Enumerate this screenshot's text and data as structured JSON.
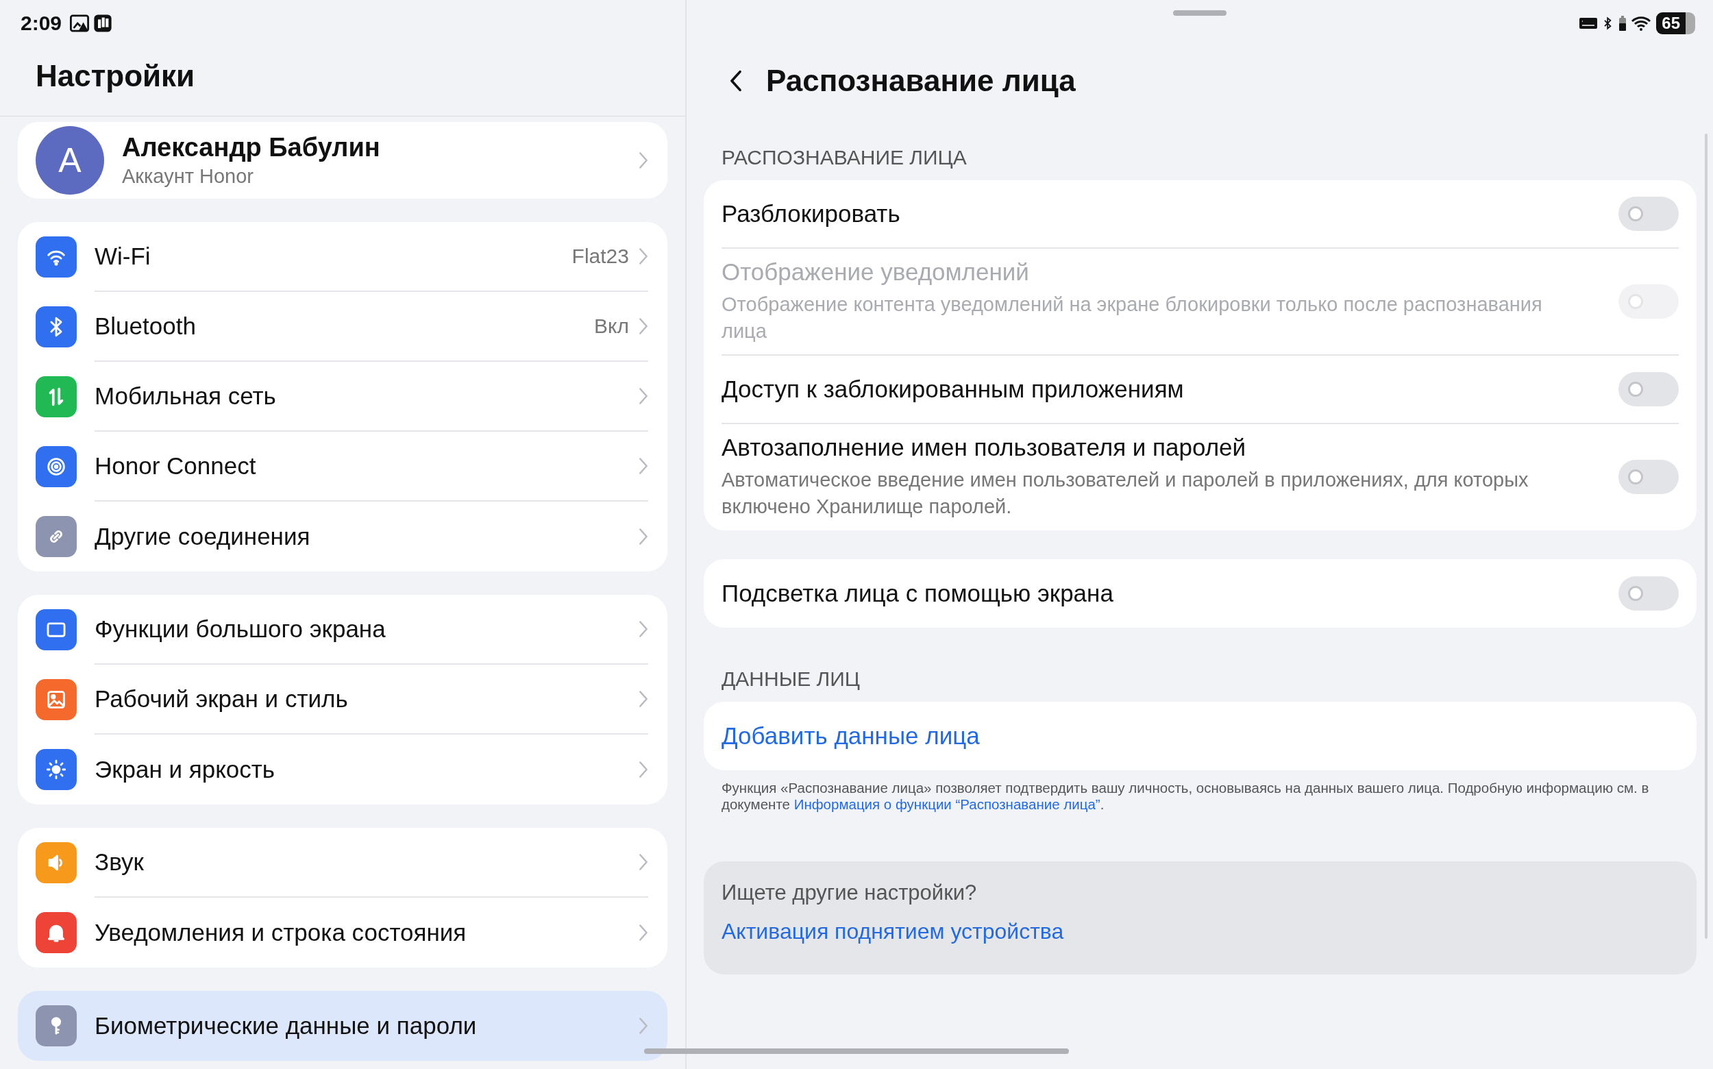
{
  "status_bar": {
    "time": "2:09",
    "battery": "65"
  },
  "sidebar": {
    "title": "Настройки",
    "profile": {
      "initial": "А",
      "name": "Александр Бабулин",
      "subtitle": "Аккаунт Honor"
    },
    "groups": [
      [
        {
          "label": "Wi-Fi",
          "value": "Flat23",
          "color": "#2f6ff0",
          "selected": false
        },
        {
          "label": "Bluetooth",
          "value": "Вкл",
          "color": "#2f6ff0",
          "selected": false
        },
        {
          "label": "Мобильная сеть",
          "color": "#20b954",
          "selected": false
        },
        {
          "label": "Honor Connect",
          "color": "#2f6ff0",
          "selected": false
        },
        {
          "label": "Другие соединения",
          "color": "#8d94b0",
          "selected": false
        }
      ],
      [
        {
          "label": "Функции большого экрана",
          "color": "#2f6ff0",
          "selected": false
        },
        {
          "label": "Рабочий экран и стиль",
          "color": "#f56a2c",
          "selected": false
        },
        {
          "label": "Экран и яркость",
          "color": "#2f6ff0",
          "selected": false
        }
      ],
      [
        {
          "label": "Звук",
          "color": "#f79a1c",
          "selected": false
        },
        {
          "label": "Уведомления и строка состояния",
          "color": "#ee4437",
          "selected": false
        }
      ],
      [
        {
          "label": "Биометрические данные и пароли",
          "color": "#8d94b0",
          "selected": true
        }
      ]
    ]
  },
  "detail": {
    "title": "Распознавание лица",
    "section_header": "РАСПОЗНАВАНИЕ ЛИЦА",
    "settings": [
      {
        "label": "Разблокировать",
        "on": false,
        "disabled": false
      },
      {
        "label": "Отображение уведомлений",
        "description": "Отображение контента уведомлений на экране блокировки только после распознавания лица",
        "on": false,
        "disabled": true
      },
      {
        "label": "Доступ к заблокированным приложениям",
        "on": false,
        "disabled": false
      },
      {
        "label": "Автозаполнение имен пользователя и паролей",
        "description": "Автоматическое введение имен пользователей и паролей в приложениях, для которых включено Хранилище паролей.",
        "on": false,
        "disabled": false
      }
    ],
    "extra_setting": {
      "label": "Подсветка лица с помощью экрана",
      "on": false,
      "disabled": false
    },
    "data_header": "ДАННЫЕ ЛИЦ",
    "add_link": "Добавить данные лица",
    "footnote": {
      "text": "Функция «Распознавание лица» позволяет подтвердить вашу личность, основываясь на данных вашего лица. Подробную информацию см. в документе ",
      "link": "Информация о функции “Распознавание лица”",
      "end": "."
    },
    "suggestions": {
      "title": "Ищете другие настройки?",
      "link": "Активация поднятием устройства"
    }
  }
}
